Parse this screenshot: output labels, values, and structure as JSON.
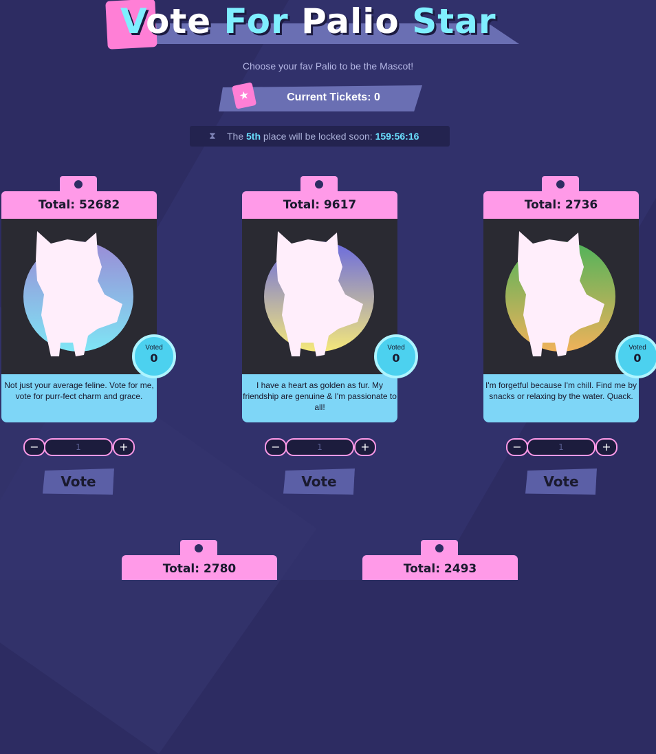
{
  "header": {
    "title_part1": "V",
    "title_part2": "ote ",
    "title_part3": "For",
    "title_part4": " Palio ",
    "title_part5": "Star",
    "subtitle": "Choose your fav Palio to be the Mascot!",
    "tickets_label": "Current Tickets: 0",
    "countdown_prefix": "The ",
    "countdown_place": "5th",
    "countdown_middle": " place will be locked soon: ",
    "countdown_time": "159:56:16"
  },
  "cards": [
    {
      "total": "Total: 52682",
      "voted_label": "Voted",
      "voted_count": "0",
      "description": "Not just your average feline. Vote for me, vote for purr-fect charm and grace.",
      "stepper_value": "1",
      "vote_label": "Vote",
      "gradient_top": "#9a8bd6",
      "gradient_bottom": "#7ee6f5"
    },
    {
      "total": "Total: 9617",
      "voted_label": "Voted",
      "voted_count": "0",
      "description": "I have a heart as golden as fur. My friendship are genuine & I'm passionate to all!",
      "stepper_value": "1",
      "vote_label": "Vote",
      "gradient_top": "#6a6adf",
      "gradient_bottom": "#f5e87a"
    },
    {
      "total": "Total: 2736",
      "voted_label": "Voted",
      "voted_count": "0",
      "description": "I'm forgetful because I'm chill. Find me by snacks or relaxing by the water. Quack.",
      "stepper_value": "1",
      "vote_label": "Vote",
      "gradient_top": "#4fb35a",
      "gradient_bottom": "#f0b25a"
    }
  ],
  "bottom_cards": [
    {
      "total": "Total: 2780"
    },
    {
      "total": "Total: 2493"
    }
  ],
  "icons": {
    "ticket": "ticket-icon",
    "hourglass": "hourglass-icon",
    "minus": "minus-icon",
    "plus": "plus-icon"
  }
}
